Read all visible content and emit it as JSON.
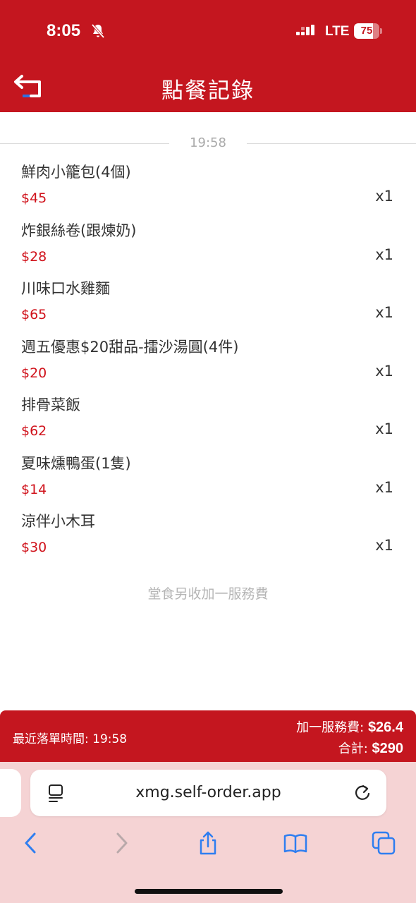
{
  "status_bar": {
    "time": "8:05",
    "network": "LTE",
    "battery_level": 75,
    "battery_text": "75"
  },
  "header": {
    "title": "點餐記錄",
    "back_icon": "back-arrow-icon"
  },
  "order": {
    "time": "19:58",
    "items": [
      {
        "name": "鮮肉小籠包(4個)",
        "price": "$45",
        "qty": "x1"
      },
      {
        "name": "炸銀絲卷(跟煉奶)",
        "price": "$28",
        "qty": "x1"
      },
      {
        "name": "川味口水雞麵",
        "price": "$65",
        "qty": "x1"
      },
      {
        "name": "週五優惠$20甜品-擂沙湯圓(4件)",
        "price": "$20",
        "qty": "x1"
      },
      {
        "name": "排骨菜飯",
        "price": "$62",
        "qty": "x1"
      },
      {
        "name": "夏味燻鴨蛋(1隻)",
        "price": "$14",
        "qty": "x1"
      },
      {
        "name": "涼伴小木耳",
        "price": "$30",
        "qty": "x1"
      }
    ],
    "note": "堂食另收加一服務費"
  },
  "footer": {
    "last_order_label": "最近落單時間: 19:58",
    "service_charge_label": "加一服務費: ",
    "service_charge_value": "$26.4",
    "total_label": "合計: ",
    "total_value": "$290"
  },
  "browser": {
    "url": "xmg.self-order.app"
  },
  "colors": {
    "brand_red": "#c4161f",
    "price_red": "#d0121b",
    "browser_bg": "#f5d3d4"
  }
}
